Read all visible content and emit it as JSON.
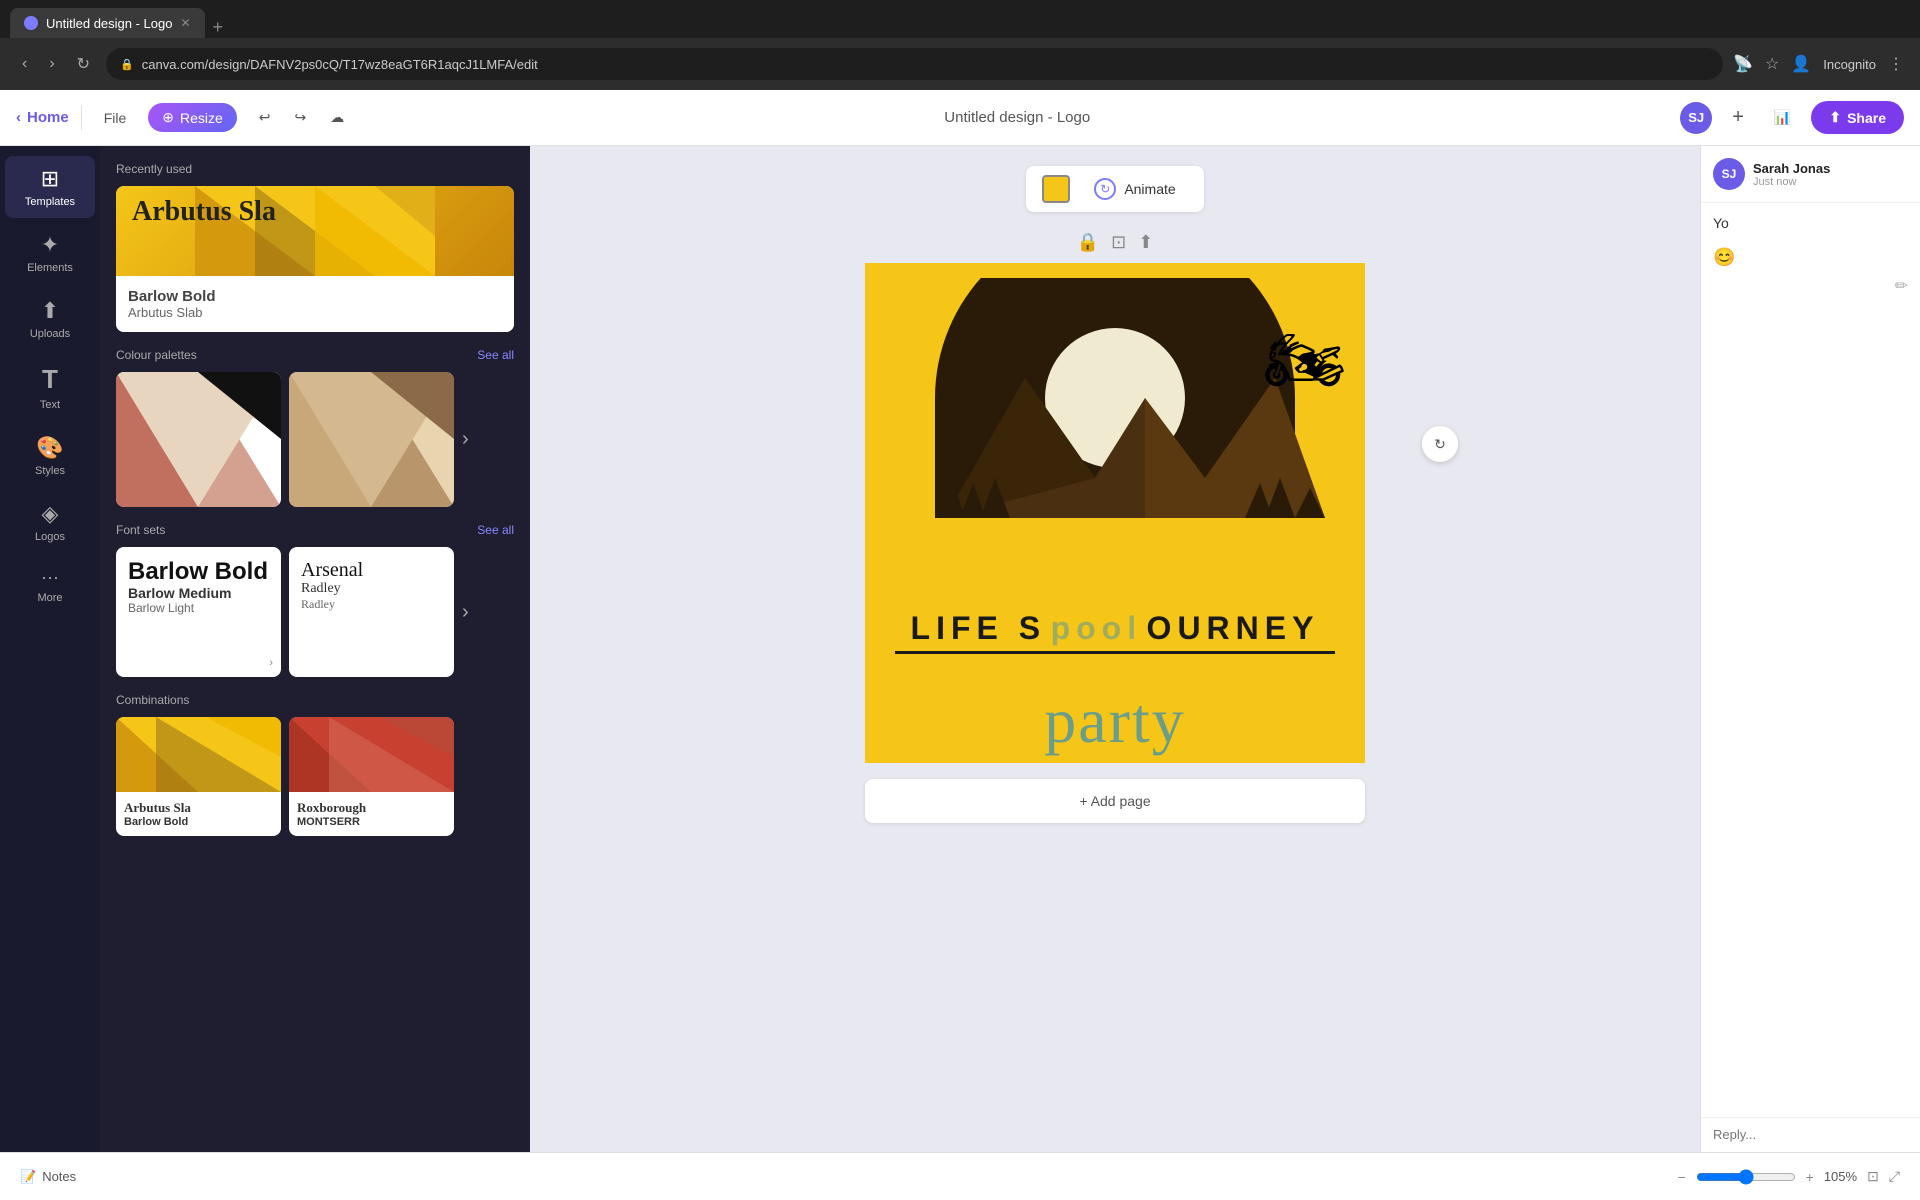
{
  "browser": {
    "tab_title": "Untitled design - Logo",
    "url": "canva.com/design/DAFNV2ps0cQ/T17wz8eaGT6R1aqcJ1LMFA/edit",
    "new_tab_icon": "+",
    "incognito_label": "Incognito"
  },
  "toolbar": {
    "home_label": "Home",
    "file_label": "File",
    "resize_label": "Resize",
    "title": "Untitled design - Logo",
    "share_label": "Share",
    "user_initials": "SJ"
  },
  "sidebar": {
    "items": [
      {
        "id": "templates",
        "label": "Templates",
        "icon": "⊞"
      },
      {
        "id": "elements",
        "label": "Elements",
        "icon": "✦"
      },
      {
        "id": "uploads",
        "label": "Uploads",
        "icon": "⬆"
      },
      {
        "id": "text",
        "label": "Text",
        "icon": "T"
      },
      {
        "id": "styles",
        "label": "Styles",
        "icon": "🎨"
      },
      {
        "id": "logos",
        "label": "Logos",
        "icon": "◈"
      },
      {
        "id": "more",
        "label": "More",
        "icon": "···"
      }
    ]
  },
  "panel": {
    "recently_used_label": "Recently used",
    "font1": "Arbutus Sla",
    "font2": "Barlow Bold",
    "font3": "Arbutus Slab",
    "color_palettes_label": "Colour palettes",
    "see_all_label": "See all",
    "font_sets_label": "Font sets",
    "fontsets": [
      {
        "name1": "Barlow Bold",
        "name2": "Barlow Medium",
        "name3": "Barlow Light"
      },
      {
        "name1": "Arsenal",
        "name2": "Radley",
        "name3": "Radley"
      }
    ],
    "combinations_label": "Combinations",
    "combos": [
      {
        "font1": "Arbutus Sla",
        "font2": "Barlow Bold"
      },
      {
        "font1": "Roxborough",
        "font2": "MONTSERR"
      }
    ]
  },
  "canvas": {
    "animate_label": "Animate",
    "life_text": "LIFE JOURNEY",
    "pool_text": "pool",
    "party_text": "party",
    "add_page_label": "+ Add page"
  },
  "comment": {
    "user_name": "Sarah Jonas",
    "user_initials": "SJ",
    "time": "Just now",
    "text": "Yo",
    "reply_placeholder": "Reply..."
  },
  "bottom_bar": {
    "notes_label": "Notes",
    "zoom_value": "105%"
  }
}
